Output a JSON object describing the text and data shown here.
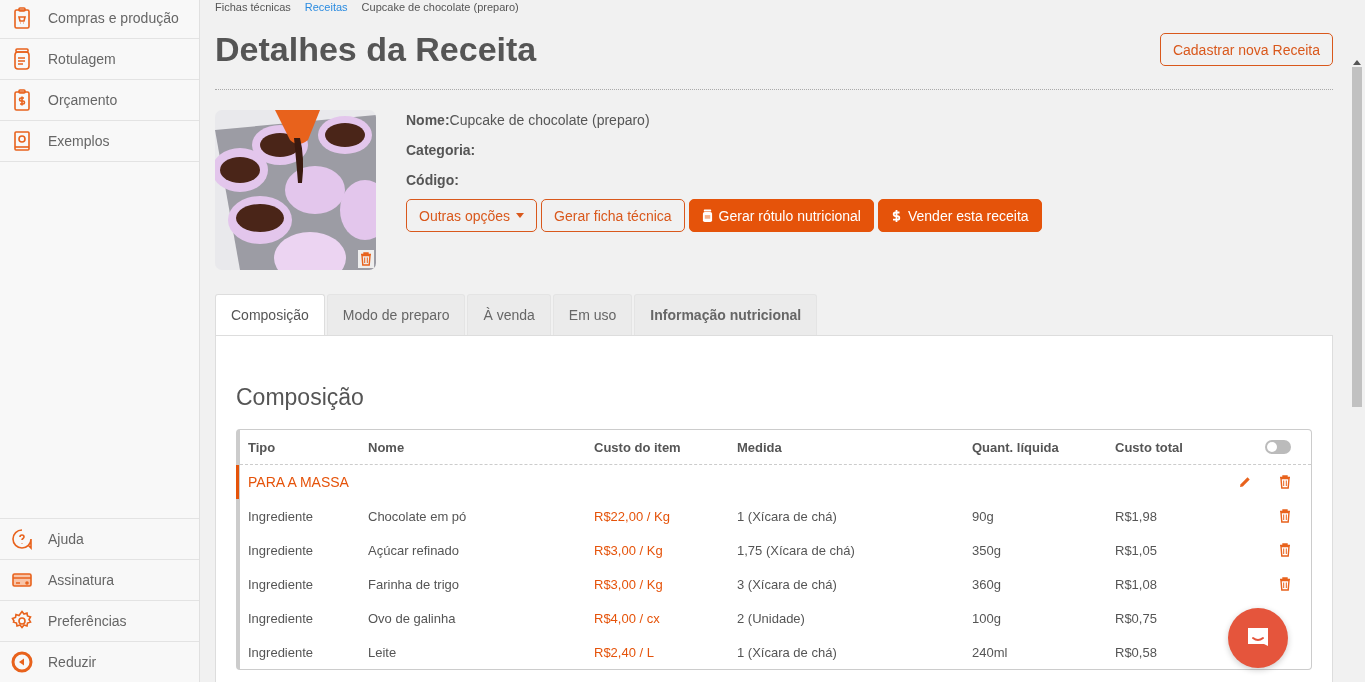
{
  "sidebar": {
    "top_items": [
      {
        "label": "Compras e produção"
      },
      {
        "label": "Rotulagem"
      },
      {
        "label": "Orçamento"
      },
      {
        "label": "Exemplos"
      }
    ],
    "bottom_items": [
      {
        "label": "Ajuda"
      },
      {
        "label": "Assinatura"
      },
      {
        "label": "Preferências"
      },
      {
        "label": "Reduzir"
      }
    ]
  },
  "breadcrumb": [
    {
      "label": "Fichas técnicas",
      "link": false
    },
    {
      "label": "Receitas",
      "link": true
    },
    {
      "label": "Cupcake de chocolate (preparo)",
      "link": false
    }
  ],
  "page_title": "Detalhes da Receita",
  "new_button": "Cadastrar nova Receita",
  "recipe": {
    "fields": [
      {
        "label": "Nome:",
        "value": "Cupcake de chocolate (preparo)"
      },
      {
        "label": "Categoria:"
      },
      {
        "label": "Código:"
      }
    ]
  },
  "actions": [
    {
      "label": "Outras opções",
      "kind": "dropdown"
    },
    {
      "label": "Gerar ficha técnica",
      "kind": "outline"
    },
    {
      "label": "Gerar rótulo nutricional",
      "kind": "label"
    },
    {
      "label": "Vender esta receita",
      "kind": "sell"
    }
  ],
  "tabs": [
    {
      "label": "Composição",
      "selected": true
    },
    {
      "label": "Modo de preparo",
      "selected": false
    },
    {
      "label": "À venda",
      "selected": false
    },
    {
      "label": "Em uso",
      "selected": false
    },
    {
      "label": "Informação nutricional",
      "selected": false
    }
  ],
  "section_title": "Composição",
  "table": {
    "columns": [
      "Tipo",
      "Nome",
      "Custo do item",
      "Medida",
      "Quant. líquida",
      "Custo total"
    ],
    "toggle_on": false,
    "groups": [
      {
        "name": "PARA A MASSA",
        "rows": [
          {
            "cells": [
              "Ingrediente",
              "Chocolate em pó",
              "R$22,00 / Kg",
              "1 (Xícara de chá)",
              "90g",
              "R$1,98"
            ]
          },
          {
            "cells": [
              "Ingrediente",
              "Açúcar refinado",
              "R$3,00 / Kg",
              "1,75 (Xícara de chá)",
              "350g",
              "R$1,05"
            ]
          },
          {
            "cells": [
              "Ingrediente",
              "Farinha de trigo",
              "R$3,00 / Kg",
              "3 (Xícara de chá)",
              "360g",
              "R$1,08"
            ]
          },
          {
            "cells": [
              "Ingrediente",
              "Ovo de galinha",
              "R$4,00 / cx",
              "2 (Unidade)",
              "100g",
              "R$0,75"
            ]
          },
          {
            "cells": [
              "Ingrediente",
              "Leite",
              "R$2,40 / L",
              "1 (Xícara de chá)",
              "240ml",
              "R$0,58"
            ]
          }
        ]
      }
    ]
  }
}
